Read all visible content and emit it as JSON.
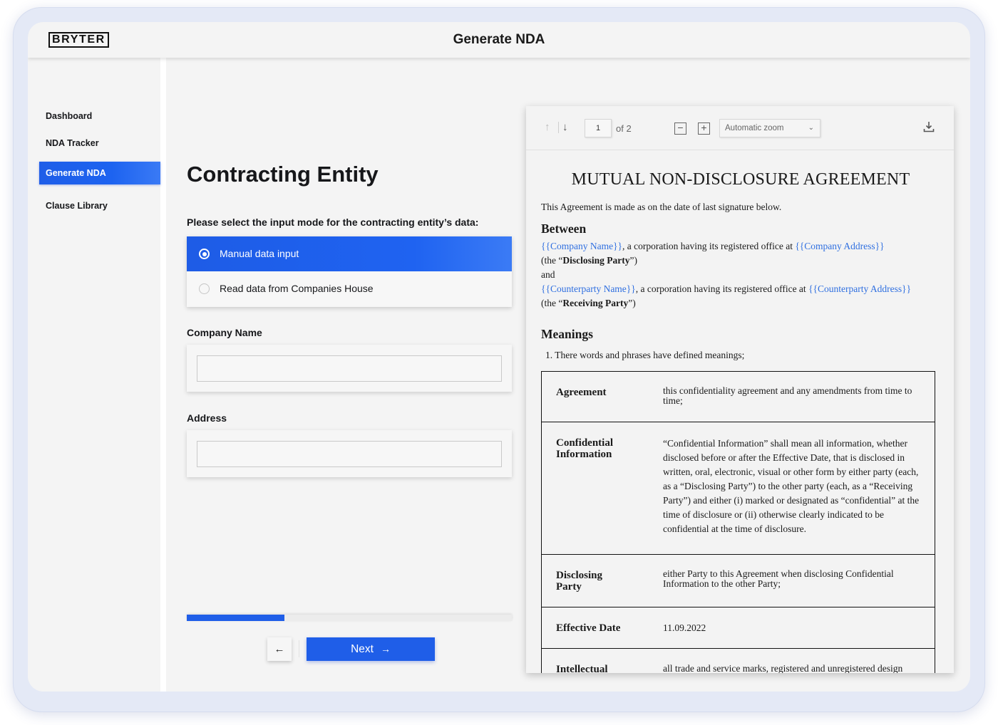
{
  "header": {
    "logo": "BRYTER",
    "title": "Generate NDA"
  },
  "sidebar": {
    "items": [
      {
        "label": "Dashboard",
        "active": false
      },
      {
        "label": "NDA Tracker",
        "active": false
      },
      {
        "label": "Generate NDA",
        "active": true
      },
      {
        "label": "Clause Library",
        "active": false
      }
    ]
  },
  "form": {
    "title": "Contracting Entity",
    "question": "Please select the input mode for the contracting entity’s data:",
    "options": [
      {
        "label": "Manual data input",
        "selected": true
      },
      {
        "label": "Read data from Companies House",
        "selected": false
      }
    ],
    "company_name": {
      "label": "Company Name",
      "value": ""
    },
    "address": {
      "label": "Address",
      "value": ""
    },
    "progress": 0.3,
    "back_icon": "arrow-left-icon",
    "next_label": "Next",
    "next_icon": "arrow-right-icon"
  },
  "viewer": {
    "page": "1",
    "of": "of 2",
    "zoom": "Automatic zoom",
    "accent": "#1f5ee8",
    "placeholder_color": "#2f6fe0"
  },
  "document": {
    "title": "MUTUAL NON-DISCLOSURE AGREEMENT",
    "intro": "This Agreement is made as on the date of last signature below.",
    "between_heading": "Between",
    "party1": {
      "name": "{{Company Name}}",
      "mid": ", a corporation having its registered office at ",
      "address": "{{Company Address}}"
    },
    "party1_role": {
      "pre": "(the “",
      "bold": "Disclosing Party",
      "post": "”)"
    },
    "and": "and",
    "party2": {
      "name": "{{Counterparty Name}}",
      "mid": ", a corporation having its registered office at ",
      "address": "{{Counterparty Address}}"
    },
    "party2_role": {
      "pre": "(the “",
      "bold": "Receiving Party",
      "post": "”)"
    },
    "meanings_heading": "Meanings",
    "meanings_item": "There words and phrases have defined meanings;",
    "definitions": [
      {
        "term": "Agreement",
        "text": "this confidentiality agreement and any amendments from time to time;"
      },
      {
        "term": "Confidential Information",
        "text": "“Confidential Information” shall mean all information, whether disclosed before or after the Effective Date, that is disclosed in written, oral, electronic, visual or other form by either party (each, as a “Disclosing Party”) to the other party (each, as a “Receiving Party”) and either (i) marked or designated as “confidential” at the time of disclosure or (ii) otherwise clearly indicated to be confidential at the time of disclosure."
      },
      {
        "term": "Disclosing Party",
        "text": "either Party to this Agreement when disclosing Confidential Information to the other Party;"
      },
      {
        "term": "Effective Date",
        "text": "11.09.2022"
      },
      {
        "term": "Intellectual",
        "text": "all trade and service marks, registered and unregistered design"
      }
    ]
  }
}
